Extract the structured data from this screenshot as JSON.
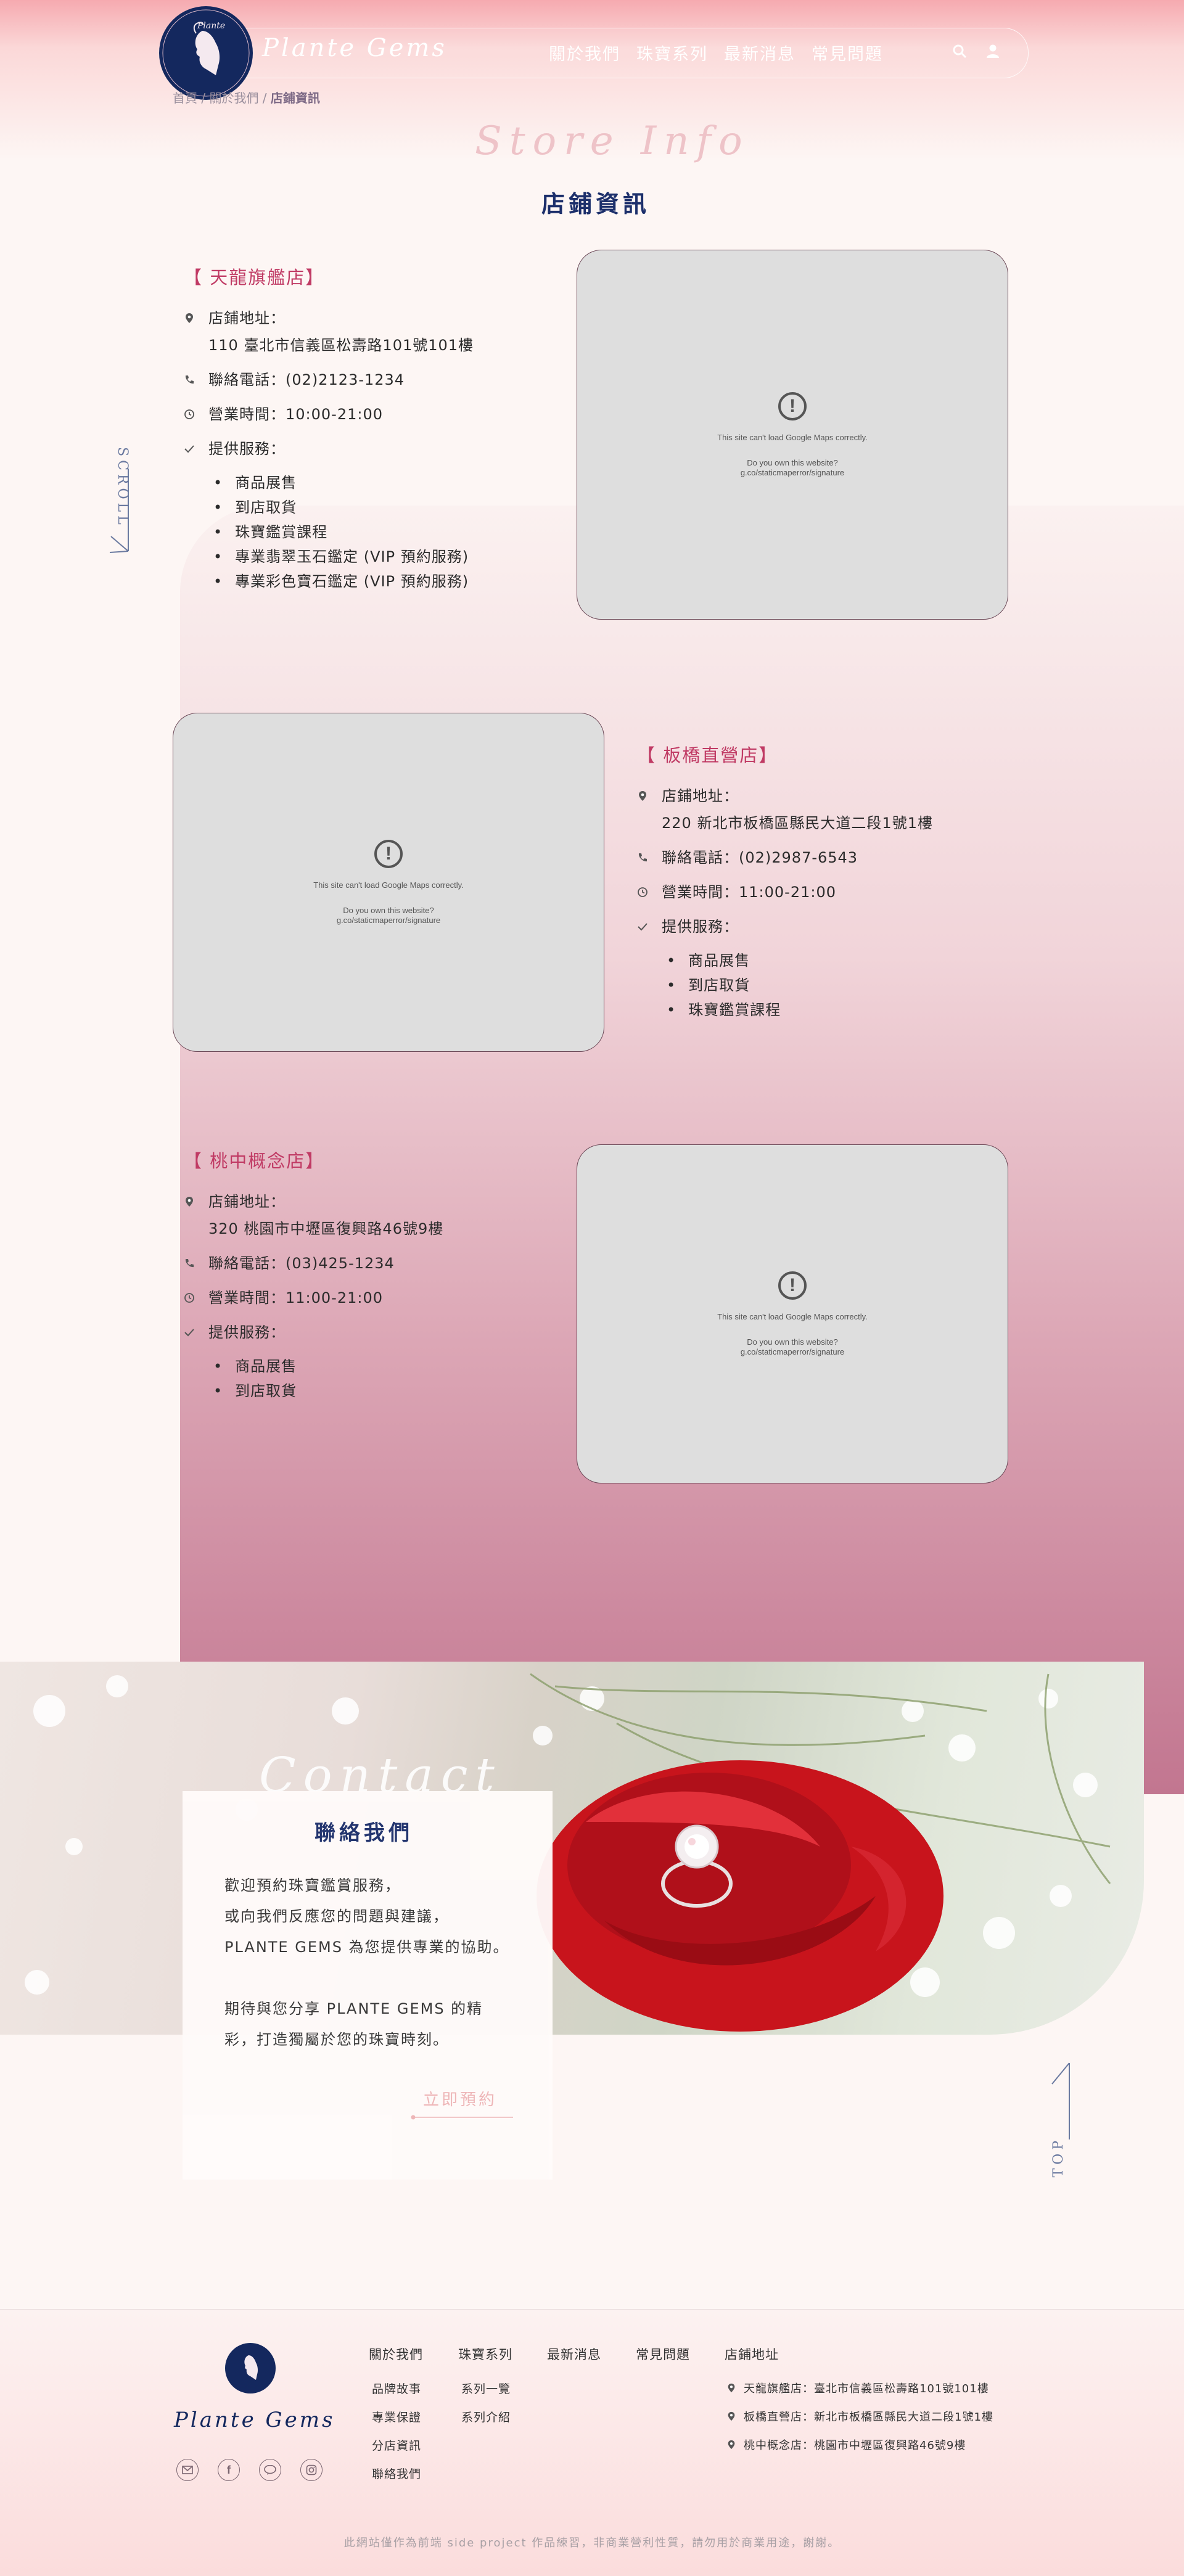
{
  "header": {
    "brand": "Plante Gems",
    "nav": [
      "關於我們",
      "珠寶系列",
      "最新消息",
      "常見問題"
    ]
  },
  "breadcrumb": {
    "home": "首頁",
    "sep1": " / ",
    "about": "關於我們",
    "sep2": " / ",
    "current": "店鋪資訊"
  },
  "page": {
    "script_title": "Store Info",
    "title": "店鋪資訊",
    "scroll": "SCROLL",
    "top": "TOP"
  },
  "stores": [
    {
      "name": "【 天龍旗艦店】",
      "address_label": "店鋪地址：",
      "address": "110 臺北市信義區松壽路101號101樓",
      "phone": "聯絡電話：(02)2123-1234",
      "hours": "營業時間：10:00-21:00",
      "services_label": "提供服務：",
      "services": [
        "商品展售",
        "到店取貨",
        "珠寶鑑賞課程",
        "專業翡翠玉石鑑定 (VIP 預約服務)",
        "專業彩色寶石鑑定 (VIP 預約服務)"
      ]
    },
    {
      "name": "【 板橋直營店】",
      "address_label": "店鋪地址：",
      "address": "220 新北市板橋區縣民大道二段1號1樓",
      "phone": "聯絡電話：(02)2987-6543",
      "hours": "營業時間：11:00-21:00",
      "services_label": "提供服務：",
      "services": [
        "商品展售",
        "到店取貨",
        "珠寶鑑賞課程"
      ]
    },
    {
      "name": "【 桃中概念店】",
      "address_label": "店鋪地址：",
      "address": "320 桃園市中壢區復興路46號9樓",
      "phone": "聯絡電話：(03)425-1234",
      "hours": "營業時間：11:00-21:00",
      "services_label": "提供服務：",
      "services": [
        "商品展售",
        "到店取貨"
      ]
    }
  ],
  "map": {
    "error": "This site can't load Google Maps correctly.",
    "own": "Do you own this website?",
    "url": "g.co/staticmaperror/signature"
  },
  "contact": {
    "script_title": "Contact",
    "title": "聯絡我們",
    "line1": "歡迎預約珠寶鑑賞服務，",
    "line2": "或向我們反應您的問題與建議，",
    "line3": "PLANTE GEMS 為您提供專業的協助。",
    "line4": "期待與您分享 PLANTE GEMS 的精",
    "line5": "彩，打造獨屬於您的珠寶時刻。",
    "cta": "立即預約"
  },
  "footer": {
    "brand": "Plante Gems",
    "cols": {
      "about": "關於我們",
      "series": "珠寶系列",
      "news": "最新消息",
      "faq": "常見問題",
      "stores": "店鋪地址"
    },
    "about_links": [
      "品牌故事",
      "專業保證",
      "分店資訊",
      "聯絡我們"
    ],
    "series_links": [
      "系列一覽",
      "系列介紹"
    ],
    "addresses": [
      "天龍旗艦店：臺北市信義區松壽路101號101樓",
      "板橋直營店：新北市板橋區縣民大道二段1號1樓",
      "桃中概念店：桃園市中壢區復興路46號9樓"
    ],
    "copyright": "此網站僅作為前端 side project 作品練習，非商業營利性質，請勿用於商業用途，謝謝。"
  },
  "colors": {
    "navy": "#14285e",
    "rose": "#c03a64",
    "panel_end": "#c27690"
  }
}
